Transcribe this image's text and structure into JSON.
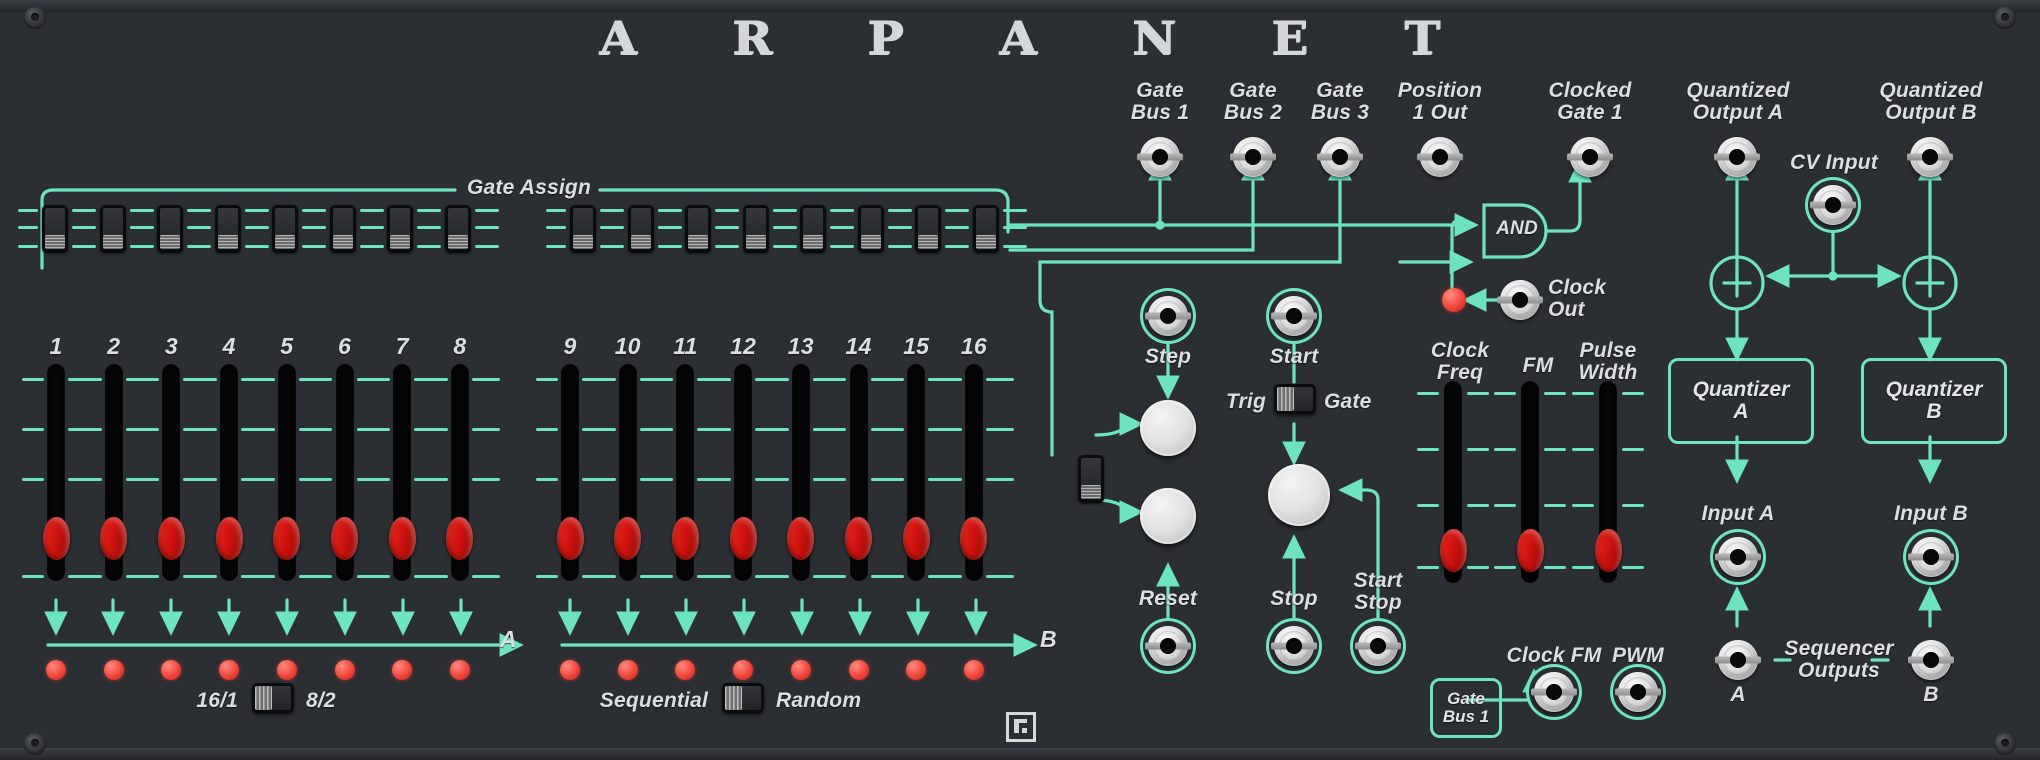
{
  "module": {
    "brand_title_glyphs": [
      "A",
      "R",
      "P",
      "A",
      "N",
      "E",
      "T"
    ],
    "brand_mark": "staircase-logo"
  },
  "gate_assign": {
    "label": "Gate Assign",
    "switch_count": 16,
    "switch_positions": [
      "bottom",
      "bottom",
      "bottom",
      "bottom",
      "bottom",
      "bottom",
      "bottom",
      "bottom",
      "bottom",
      "bottom",
      "bottom",
      "bottom",
      "bottom",
      "bottom",
      "bottom",
      "bottom"
    ]
  },
  "outputs": {
    "gate_bus_1": "Gate\nBus 1",
    "gate_bus_2": "Gate\nBus 2",
    "gate_bus_3": "Gate\nBus 3",
    "position_1_out": "Position\n1 Out",
    "clocked_gate_1": "Clocked\nGate 1",
    "and_gate": "AND",
    "quantized_output_a": "Quantized\nOutput A",
    "quantized_output_b": "Quantized\nOutput B",
    "cv_input": "CV Input",
    "quantizer_a": "Quantizer\nA",
    "quantizer_b": "Quantizer\nB",
    "input_a": "Input A",
    "input_b": "Input B",
    "sequencer_outputs": "Sequencer\nOutputs",
    "seq_out_a": "A",
    "seq_out_b": "B"
  },
  "transport": {
    "step": "Step",
    "start": "Start",
    "reset": "Reset",
    "stop": "Stop",
    "start_stop": "Start\nStop",
    "trig": "Trig",
    "gate": "Gate",
    "trig_gate_position": "left"
  },
  "clock": {
    "clock_out": "Clock\nOut",
    "clock_freq": "Clock\nFreq",
    "fm": "FM",
    "pulse_width": "Pulse\nWidth",
    "clock_fm": "Clock FM",
    "pwm": "PWM",
    "gate_bus_1_box": "Gate\nBus 1",
    "slider_values": [
      0.88,
      0.88,
      0.88
    ]
  },
  "sequencer": {
    "group_a_label": "A",
    "group_b_label": "B",
    "step_numbers": [
      "1",
      "2",
      "3",
      "4",
      "5",
      "6",
      "7",
      "8",
      "9",
      "10",
      "11",
      "12",
      "13",
      "14",
      "15",
      "16"
    ],
    "fader_values": [
      0.82,
      0.82,
      0.82,
      0.82,
      0.82,
      0.82,
      0.82,
      0.82,
      0.82,
      0.82,
      0.82,
      0.82,
      0.82,
      0.82,
      0.82,
      0.82
    ],
    "step_leds_lit": [
      true,
      true,
      true,
      true,
      true,
      true,
      true,
      true,
      true,
      true,
      true,
      true,
      true,
      true,
      true,
      true
    ],
    "length_switch": {
      "left": "16/1",
      "right": "8/2",
      "position": "left"
    },
    "mode_switch": {
      "left": "Sequential",
      "right": "Random",
      "position": "left"
    }
  },
  "colors": {
    "panel": "#2b2e32",
    "accent_teal": "#6ee3c2",
    "led_red": "#f0453a",
    "fader_cap_red": "#d41810",
    "text": "#dcdfe2"
  }
}
